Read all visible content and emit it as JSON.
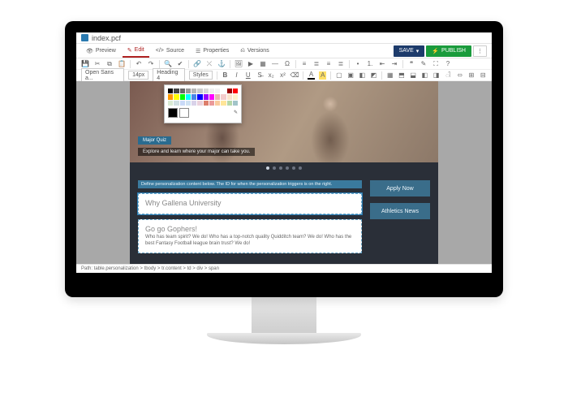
{
  "file": {
    "name": "index.pcf",
    "icon": "doc-icon"
  },
  "tabs": [
    {
      "id": "preview",
      "label": "Preview",
      "icon": "👁"
    },
    {
      "id": "edit",
      "label": "Edit",
      "icon": "✎"
    },
    {
      "id": "source",
      "label": "Source",
      "icon": "</>"
    },
    {
      "id": "properties",
      "label": "Properties",
      "icon": "☰"
    },
    {
      "id": "versions",
      "label": "Versions",
      "icon": "⎌"
    }
  ],
  "active_tab": "edit",
  "actions": {
    "save": {
      "label": "SAVE"
    },
    "publish": {
      "label": "PUBLISH"
    },
    "more": {
      "label": "⋮"
    }
  },
  "toolbar2": {
    "font_family": "Open Sans a...",
    "font_size": "14px",
    "heading": "Heading 4",
    "styles": "Styles"
  },
  "colorpicker": {
    "rows": [
      [
        "#000000",
        "#434343",
        "#666666",
        "#999999",
        "#b7b7b7",
        "#cccccc",
        "#d9d9d9",
        "#efefef",
        "#f3f3f3",
        "#ffffff",
        "#980000",
        "#ff0000"
      ],
      [
        "#ff9900",
        "#ffff00",
        "#00ff00",
        "#00ffff",
        "#4a86e8",
        "#0000ff",
        "#9900ff",
        "#ff00ff",
        "#e6b8af",
        "#f4cccc",
        "#fce5cd",
        "#fff2cc"
      ],
      [
        "#d9ead3",
        "#d0e0e3",
        "#c9daf8",
        "#cfe2f3",
        "#d9d2e9",
        "#ead1dc",
        "#dd7e6b",
        "#ea9999",
        "#f9cb9c",
        "#ffe599",
        "#b6d7a8",
        "#a2c4c9"
      ]
    ],
    "black": "#000000",
    "white": "#ffffff",
    "eyedropper_label": "✎"
  },
  "hero": {
    "badge": "Major Quiz",
    "caption": "Explore and learn where your major can take you."
  },
  "carousel": {
    "count": 6,
    "active": 0
  },
  "perso_strip": "Define personalization content below. The ID for when the personalization triggers is on the right.",
  "cards": [
    {
      "title": "Why Gallena University",
      "body": ""
    },
    {
      "title": "Go go Gophers!",
      "body": "Who has team spirit? We do! Who has a top-notch quality Quidditch team? We do! Who has the best Fantasy Football league brain trust? We do!"
    }
  ],
  "sidebar_buttons": [
    {
      "label": "Apply Now"
    },
    {
      "label": "Athletics News"
    }
  ],
  "status": "Path: table.personalization > tbody > tr.content > td > div > span"
}
